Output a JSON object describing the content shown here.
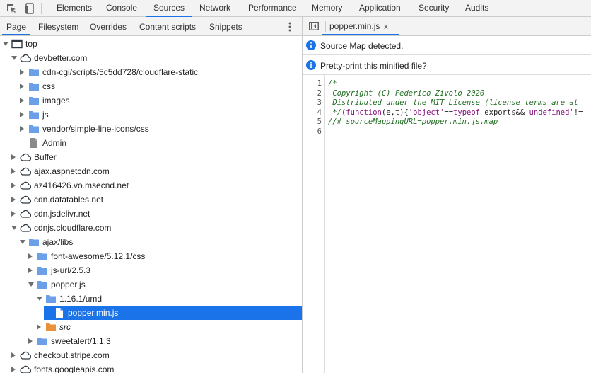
{
  "panel_tabs": [
    {
      "label": "Elements",
      "selected": false
    },
    {
      "label": "Console",
      "selected": false
    },
    {
      "label": "Sources",
      "selected": true
    },
    {
      "label": "Network",
      "selected": false
    },
    {
      "label": "Performance",
      "selected": false
    },
    {
      "label": "Memory",
      "selected": false
    },
    {
      "label": "Application",
      "selected": false
    },
    {
      "label": "Security",
      "selected": false
    },
    {
      "label": "Audits",
      "selected": false
    }
  ],
  "navigator": {
    "tabs": [
      {
        "label": "Page",
        "selected": true
      },
      {
        "label": "Filesystem",
        "selected": false
      },
      {
        "label": "Overrides",
        "selected": false
      },
      {
        "label": "Content scripts",
        "selected": false
      },
      {
        "label": "Snippets",
        "selected": false
      }
    ],
    "tree": [
      {
        "label": "top",
        "icon": "frame-icon",
        "arrow": "down"
      },
      {
        "label": "devbetter.com",
        "icon": "cloud-icon",
        "arrow": "down"
      },
      {
        "label": "cdn-cgi/scripts/5c5dd728/cloudflare-static",
        "icon": "folder-icon",
        "arrow": "right"
      },
      {
        "label": "css",
        "icon": "folder-icon",
        "arrow": "right"
      },
      {
        "label": "images",
        "icon": "folder-icon",
        "arrow": "right"
      },
      {
        "label": "js",
        "icon": "folder-icon",
        "arrow": "right"
      },
      {
        "label": "vendor/simple-line-icons/css",
        "icon": "folder-icon",
        "arrow": "right"
      },
      {
        "label": "Admin",
        "icon": "file-icon",
        "arrow": "none"
      },
      {
        "label": "Buffer",
        "icon": "cloud-icon",
        "arrow": "right"
      },
      {
        "label": "ajax.aspnetcdn.com",
        "icon": "cloud-icon",
        "arrow": "right"
      },
      {
        "label": "az416426.vo.msecnd.net",
        "icon": "cloud-icon",
        "arrow": "right"
      },
      {
        "label": "cdn.datatables.net",
        "icon": "cloud-icon",
        "arrow": "right"
      },
      {
        "label": "cdn.jsdelivr.net",
        "icon": "cloud-icon",
        "arrow": "right"
      },
      {
        "label": "cdnjs.cloudflare.com",
        "icon": "cloud-icon",
        "arrow": "down"
      },
      {
        "label": "ajax/libs",
        "icon": "folder-icon",
        "arrow": "down"
      },
      {
        "label": "font-awesome/5.12.1/css",
        "icon": "folder-icon",
        "arrow": "right"
      },
      {
        "label": "js-url/2.5.3",
        "icon": "folder-icon",
        "arrow": "right"
      },
      {
        "label": "popper.js",
        "icon": "folder-icon",
        "arrow": "down"
      },
      {
        "label": "1.16.1/umd",
        "icon": "folder-icon",
        "arrow": "down"
      },
      {
        "label": "popper.min.js",
        "icon": "file-icon",
        "arrow": "none"
      },
      {
        "label": "src",
        "icon": "folder-orange-icon",
        "arrow": "right"
      },
      {
        "label": "sweetalert/1.1.3",
        "icon": "folder-icon",
        "arrow": "right"
      },
      {
        "label": "checkout.stripe.com",
        "icon": "cloud-icon",
        "arrow": "right"
      },
      {
        "label": "fonts.googleapis.com",
        "icon": "cloud-icon",
        "arrow": "right"
      }
    ]
  },
  "editor": {
    "file_tab": "popper.min.js",
    "close_glyph": "×",
    "infobars": [
      "Source Map detected.",
      "Pretty-print this minified file?"
    ],
    "line_numbers": [
      "1",
      "2",
      "3",
      "4",
      "5",
      "6"
    ],
    "lines": [
      "/*",
      " Copyright (C) Federico Zivolo 2020",
      " Distributed under the MIT License (license terms are at",
      " */(function(e,t){'object'==typeof exports&&'undefined'!=",
      "//# sourceMappingURL=popper.min.js.map",
      ""
    ]
  },
  "colors": {
    "accent": "#1a73e8",
    "folder": "#6ba0e8",
    "folder_orange": "#e8903a",
    "comment": "#236e25"
  }
}
